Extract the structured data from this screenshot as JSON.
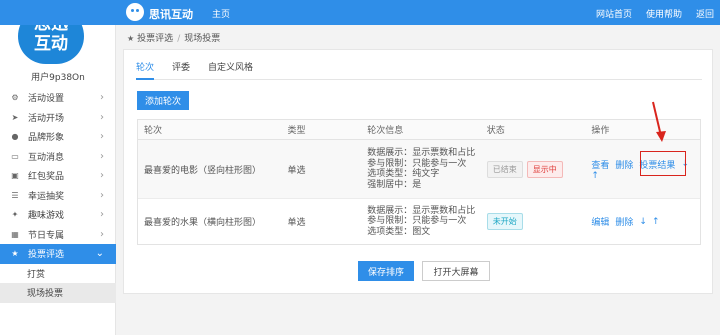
{
  "topbar": {
    "brand": "思讯互动",
    "home": "主页",
    "links": [
      "网站首页",
      "使用帮助",
      "返回"
    ],
    "color": "#2f8ee8"
  },
  "sidebar": {
    "logo_line1": "思迅",
    "logo_line2": "互动",
    "username": "用户9p38On",
    "items": [
      {
        "icon": "gear-icon",
        "label": "活动设置"
      },
      {
        "icon": "send-icon",
        "label": "活动开场"
      },
      {
        "icon": "badge-icon",
        "label": "品牌形象"
      },
      {
        "icon": "message-icon",
        "label": "互动消息"
      },
      {
        "icon": "gift-icon",
        "label": "红包奖品"
      },
      {
        "icon": "list-icon",
        "label": "幸运抽奖"
      },
      {
        "icon": "game-icon",
        "label": "趣味游戏"
      },
      {
        "icon": "calendar-icon",
        "label": "节日专属"
      },
      {
        "icon": "star-icon",
        "label": "投票评选",
        "active": true
      }
    ],
    "subitems": [
      {
        "label": "打赏"
      },
      {
        "label": "现场投票",
        "current": true
      }
    ]
  },
  "breadcrumb": {
    "first": "投票评选",
    "separator": "/",
    "second": "现场投票"
  },
  "tabs": [
    {
      "label": "轮次",
      "active": true
    },
    {
      "label": "评委"
    },
    {
      "label": "自定义风格"
    }
  ],
  "add_round_label": "添加轮次",
  "table": {
    "headers": [
      "轮次",
      "类型",
      "轮次信息",
      "状态",
      "操作"
    ],
    "rows": [
      {
        "name": "最喜爱的电影（竖向柱形图）",
        "type": "单选",
        "info": [
          "数据展示：显示票数和占比",
          "参与限制：只能参与一次",
          "选项类型：纯文字",
          "强制居中：是"
        ],
        "badges": [
          {
            "text": "已结束",
            "style": "grey"
          },
          {
            "text": "显示中",
            "style": "red"
          }
        ],
        "ops": [
          "查看",
          "删除",
          "投票结果"
        ],
        "arrows": [
          "↓",
          "↑"
        ]
      },
      {
        "name": "最喜爱的水果（横向柱形图）",
        "type": "单选",
        "info": [
          "数据展示：显示票数和占比",
          "参与限制：只能参与一次",
          "选项类型：图文"
        ],
        "badges": [
          {
            "text": "未开始",
            "style": "cyan"
          }
        ],
        "ops": [
          "编辑",
          "删除"
        ],
        "arrows": [
          "↓",
          "↑"
        ]
      }
    ]
  },
  "save_order_label": "保存排序",
  "open_screen_label": "打开大屏幕"
}
